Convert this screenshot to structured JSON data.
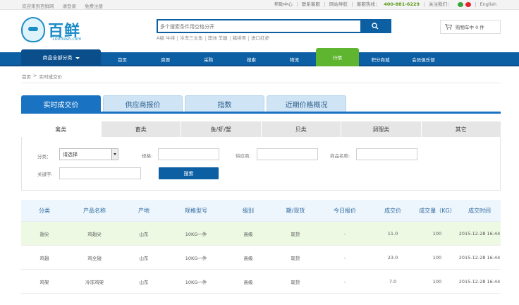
{
  "topbar": {
    "welcome": "欢迎来到百鲜网",
    "login": "请登录",
    "register": "免费注册",
    "help": "帮助中心",
    "contact": "联系客服",
    "sitemap": "网站导航",
    "hotline_label": "客服热线：",
    "hotline": "400-881-6229",
    "follow": "关注我们：",
    "english": "English"
  },
  "logo": {
    "brand": "百鲜",
    "sub": "100fresh.com"
  },
  "search": {
    "placeholder": "多个搜索条件用空格分开",
    "hotwords": [
      "A级 牛排",
      "冷冻三文鱼",
      "澳洲 羊腿",
      "猪排骨",
      "进口红虾"
    ]
  },
  "cart": {
    "label": "购物车中 0 件"
  },
  "nav": {
    "all_categories": "商品全部分类",
    "items": [
      "首页",
      "资源",
      "采购",
      "搜索",
      "物流",
      "行情",
      "积分商城",
      "会员俱乐部"
    ],
    "active_index": 5
  },
  "breadcrumb": [
    "首页",
    ">",
    "实时成交价"
  ],
  "main_tabs": [
    {
      "label": "实时成交价",
      "active": true
    },
    {
      "label": "供应商报价",
      "active": false
    },
    {
      "label": "指数",
      "active": false
    },
    {
      "label": "近期价格概况",
      "active": false
    }
  ],
  "category_tabs": [
    "禽类",
    "畜类",
    "鱼/虾/蟹",
    "贝类",
    "调理类",
    "其它"
  ],
  "filter": {
    "category_label": "分类：",
    "category_value": "请选择",
    "spec_label": "规格:",
    "supplier_label": "供应商:",
    "product_label": "商品名称:",
    "keyword_label": "关键字:",
    "search_button": "搜索"
  },
  "table": {
    "headers": [
      "分类",
      "产品名称",
      "产地",
      "规格型号",
      "级别",
      "期/现货",
      "今日报价",
      "成交价",
      "成交量（KG）",
      "成交时间"
    ],
    "rows": [
      [
        "翅尖",
        "鸡翅尖",
        "山东",
        "10KG一件",
        "高级",
        "现货",
        "-",
        "11.0",
        "100",
        "2015-12-28 16:44"
      ],
      [
        "鸡翅",
        "鸡全翅",
        "山东",
        "10KG一件",
        "高级",
        "现货",
        "-",
        "23.0",
        "100",
        "2015-12-28 16:44"
      ],
      [
        "鸡架",
        "冷冻鸡架",
        "山东",
        "10KG一件",
        "高级",
        "现货",
        "-",
        "7.0",
        "100",
        "2015-12-28 16:44"
      ]
    ]
  },
  "colors": {
    "primary": "#0d5fa4",
    "tab_active": "#1a73c2",
    "nav_active": "#5fb530",
    "row_highlight": "#eef9e4",
    "hotline": "#5a9a18"
  }
}
